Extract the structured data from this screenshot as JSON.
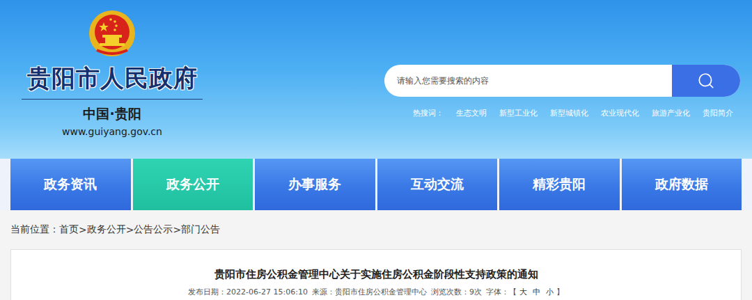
{
  "site": {
    "title": "贵阳市人民政府",
    "subtitle": "中国·贵阳",
    "url": "www.guiyang.gov.cn"
  },
  "search": {
    "placeholder": "请输入您需要搜索的内容",
    "hot_label": "热搜词：",
    "hot_words": [
      "生态文明",
      "新型工业化",
      "新型城镇化",
      "农业现代化",
      "旅游产业化",
      "贵阳简介"
    ]
  },
  "nav": {
    "tabs": [
      {
        "label": "政务资讯",
        "selected": false
      },
      {
        "label": "政务公开",
        "selected": true
      },
      {
        "label": "办事服务",
        "selected": false
      },
      {
        "label": "互动交流",
        "selected": false
      },
      {
        "label": "精彩贵阳",
        "selected": false
      },
      {
        "label": "政府数据",
        "selected": false
      }
    ]
  },
  "breadcrumb": {
    "label": "当前位置：",
    "separator": ">",
    "items": [
      "首页",
      "政务公开",
      "公告公示",
      "部门公告"
    ]
  },
  "article": {
    "title": "贵阳市住房公积金管理中心关于实施住房公积金阶段性支持政策的通知",
    "meta": [
      {
        "label": "发布日期：",
        "value": "2022-06-27 15:06:10"
      },
      {
        "label": "来源：",
        "value": "贵阳市住房公积金管理中心"
      },
      {
        "label": "浏览次数：",
        "value": "9次"
      }
    ],
    "font_size": {
      "label": "字体：",
      "open": "【",
      "sizes": [
        "大",
        "中",
        "小"
      ],
      "close": "】"
    }
  }
}
